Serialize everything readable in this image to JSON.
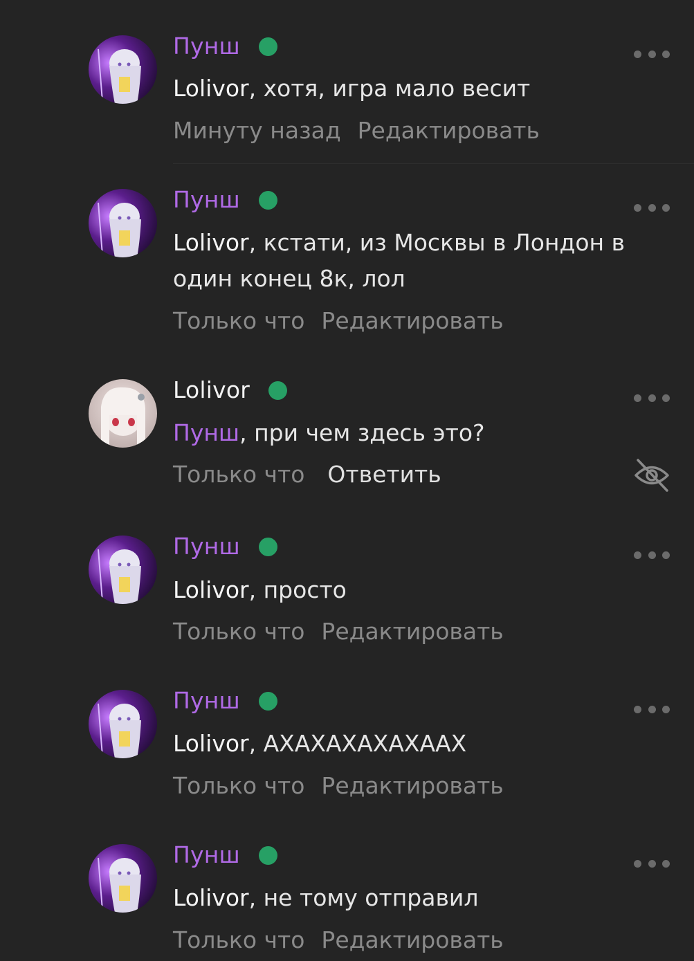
{
  "colors": {
    "background": "#242424",
    "author_purple": "#b06ae6",
    "online_green": "#27a065",
    "muted": "#8a8a8a"
  },
  "comments": [
    {
      "author": "Пунш",
      "online": true,
      "mention": "Lolivor",
      "text": ", хотя, игра мало весит",
      "time": "Минуту назад",
      "action": "Редактировать",
      "menu_icon": "more-horizontal-icon"
    },
    {
      "author": "Пунш",
      "online": true,
      "mention": "Lolivor",
      "text": ", кстати, из Москвы в Лондон в один конец 8к, лол",
      "time": "Только что",
      "action": "Редактировать",
      "menu_icon": "more-horizontal-icon"
    },
    {
      "author": "Lolivor",
      "online": true,
      "mention": "Пунш",
      "text": ", при чем здесь это?",
      "time": "Только что",
      "action": "Ответить",
      "menu_icon": "more-horizontal-icon",
      "extra_icon": "eye-off-icon"
    },
    {
      "author": "Пунш",
      "online": true,
      "mention": "Lolivor",
      "text": ", просто",
      "time": "Только что",
      "action": "Редактировать",
      "menu_icon": "more-horizontal-icon"
    },
    {
      "author": "Пунш",
      "online": true,
      "mention": "Lolivor",
      "text": ", АХАХАХАХАХААХ",
      "time": "Только что",
      "action": "Редактировать",
      "menu_icon": "more-horizontal-icon"
    },
    {
      "author": "Пунш",
      "online": true,
      "mention": "Lolivor",
      "text": ", не тому отправил",
      "time": "Только что",
      "action": "Редактировать",
      "menu_icon": "more-horizontal-icon"
    }
  ]
}
